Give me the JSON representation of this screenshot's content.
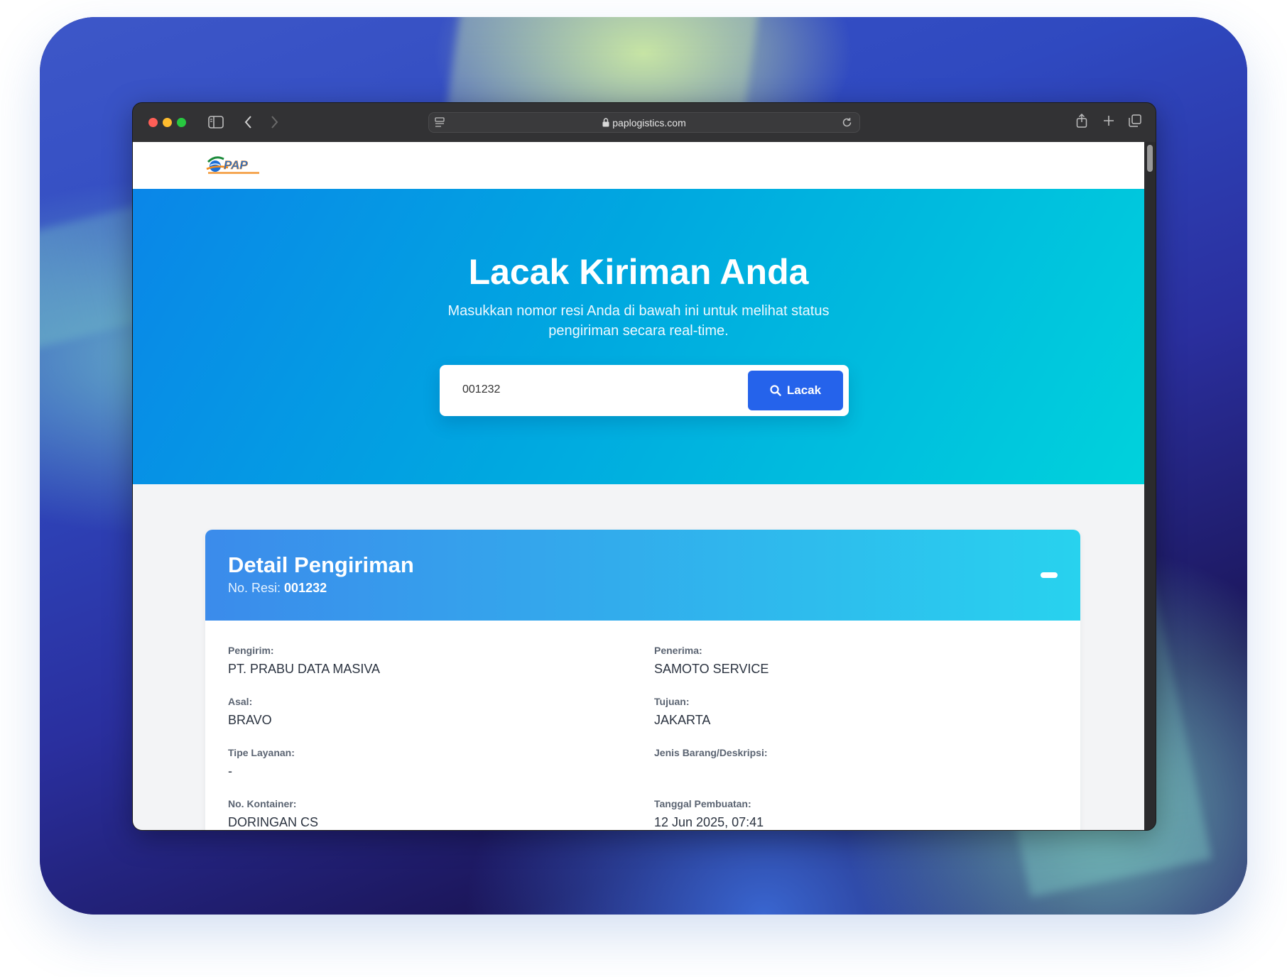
{
  "browser": {
    "url": "paplogistics.com"
  },
  "logo": {
    "alt": "PAP"
  },
  "hero": {
    "title": "Lacak Kiriman Anda",
    "subtitle_line1": "Masukkan nomor resi Anda di bawah ini untuk melihat status",
    "subtitle_line2": "pengiriman secara real-time."
  },
  "search": {
    "value": "001232",
    "button_label": "Lacak"
  },
  "detail": {
    "title": "Detail Pengiriman",
    "resi_label": "No. Resi:",
    "resi_value": "001232",
    "fields": [
      {
        "label": "Pengirim:",
        "value": "PT. PRABU DATA MASIVA"
      },
      {
        "label": "Penerima:",
        "value": "SAMOTO SERVICE"
      },
      {
        "label": "Asal:",
        "value": "BRAVO"
      },
      {
        "label": "Tujuan:",
        "value": "JAKARTA"
      },
      {
        "label": "Tipe Layanan:",
        "value": "-"
      },
      {
        "label": "Jenis Barang/Deskripsi:",
        "value": ""
      },
      {
        "label": "No. Kontainer:",
        "value": "DORINGAN CS"
      },
      {
        "label": "Tanggal Pembuatan:",
        "value": "12 Jun 2025, 07:41"
      }
    ]
  },
  "colors": {
    "primary_button": "#2563eb",
    "hero_start": "#0a86e8",
    "hero_end": "#00d2dc"
  }
}
